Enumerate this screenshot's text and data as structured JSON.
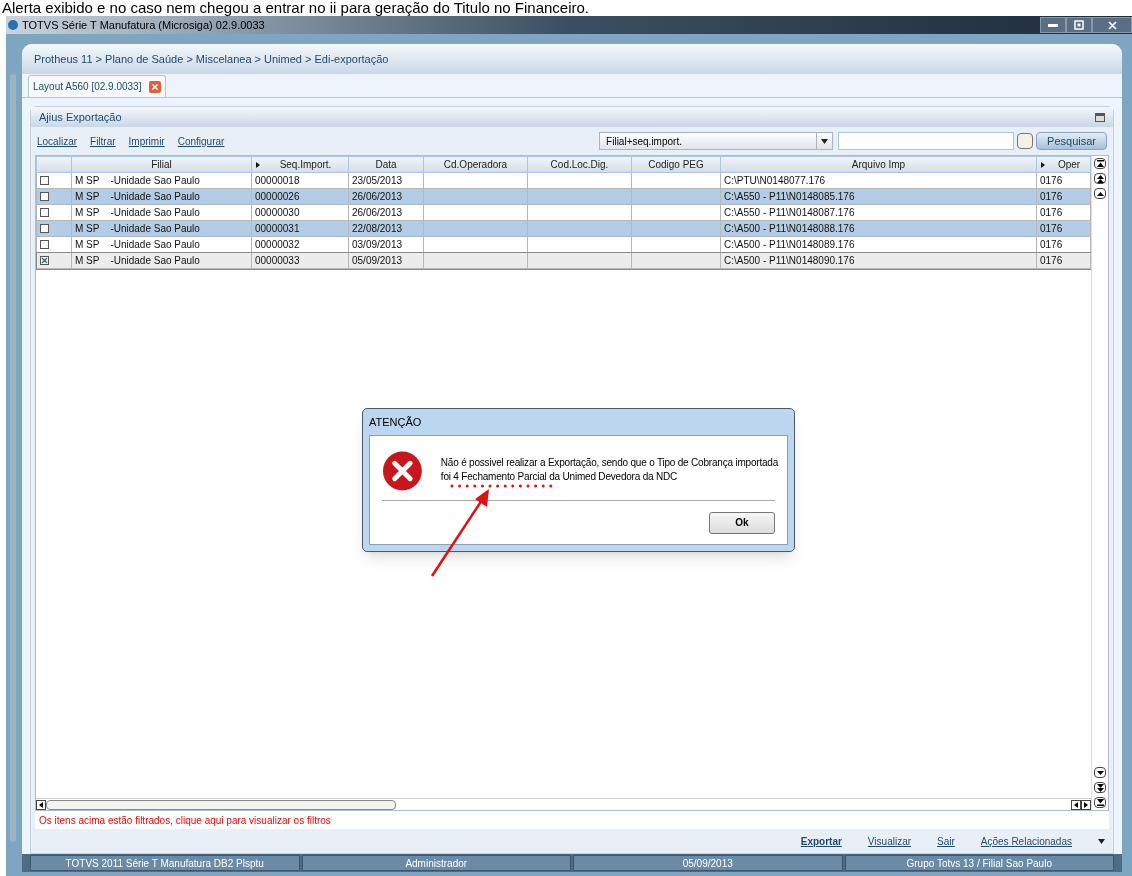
{
  "caption": "Alerta exibido e no caso nem chegou a entrar no ii para geração do Titulo no Financeiro.",
  "window": {
    "title": "TOTVS Série T Manufatura (Microsiga) 02.9.0033"
  },
  "breadcrumb": "Protheus 11 > Plano de Saúde > Miscelanea > Unimed > Edi-exportação",
  "tabs": [
    {
      "label": "Layout A560 [02.9.0033]",
      "selected": true
    }
  ],
  "panel": {
    "title": "Ajius Exportação"
  },
  "toolbar_links": [
    "Localizar",
    "Filtrar",
    "Imprimir",
    "Configurar"
  ],
  "search": {
    "index": "Filial+seq.import.",
    "button": "Pesquisar"
  },
  "table": {
    "columns": [
      {
        "label": "Filial",
        "sort": false
      },
      {
        "label": "Seq.Import.",
        "sort": true
      },
      {
        "label": "Data",
        "sort": false
      },
      {
        "label": "Cd.Operadora",
        "sort": false
      },
      {
        "label": "Cod.Loc.Dig.",
        "sort": false
      },
      {
        "label": "Codigo PEG",
        "sort": false
      },
      {
        "label": "Arquivo Imp",
        "sort": false
      },
      {
        "label": "Oper",
        "sort": true
      }
    ],
    "rows": [
      {
        "checked": false,
        "selected": false,
        "current": false,
        "cells": [
          "M SP    -Unidade Sao Paulo",
          "00000018",
          "23/05/2013",
          "",
          "",
          "",
          "C:\\PTU\\N0148077.176",
          "0176"
        ]
      },
      {
        "checked": false,
        "selected": true,
        "current": false,
        "cells": [
          "M SP    -Unidade Sao Paulo",
          "00000026",
          "26/06/2013",
          "",
          "",
          "",
          "C:\\A550 - P11\\N0148085.176",
          "0176"
        ]
      },
      {
        "checked": false,
        "selected": false,
        "current": false,
        "cells": [
          "M SP    -Unidade Sao Paulo",
          "00000030",
          "26/06/2013",
          "",
          "",
          "",
          "C:\\A550 - P11\\N0148087.176",
          "0176"
        ]
      },
      {
        "checked": false,
        "selected": true,
        "current": false,
        "cells": [
          "M SP    -Unidade Sao Paulo",
          "00000031",
          "22/08/2013",
          "",
          "",
          "",
          "C:\\A500 - P11\\N0148088.176",
          "0176"
        ]
      },
      {
        "checked": false,
        "selected": false,
        "current": false,
        "cells": [
          "M SP    -Unidade Sao Paulo",
          "00000032",
          "03/09/2013",
          "",
          "",
          "",
          "C:\\A500 - P11\\N0148089.176",
          "0176"
        ]
      },
      {
        "checked": true,
        "selected": false,
        "current": true,
        "cells": [
          "M SP    -Unidade Sao Paulo",
          "00000033",
          "05/09/2013",
          "",
          "",
          "",
          "C:\\A500 - P11\\N0148090.176",
          "0176"
        ]
      }
    ]
  },
  "filter_notice": "Os itens acima estão filtrados, clique aqui para visualizar os filtros",
  "actions": [
    {
      "label": "Exportar",
      "bold": true
    },
    {
      "label": "Visualizar",
      "bold": false
    },
    {
      "label": "Sair",
      "bold": false
    },
    {
      "label": "Ações Relacionadas",
      "bold": false
    }
  ],
  "status_bar": [
    "TOTVS 2011 Série T Manufatura DB2 Plsptu",
    "Administrador",
    "05/09/2013",
    "Grupo Totvs 13 / Filial Sao Paulo"
  ],
  "dialog": {
    "title": "ATENÇÃO",
    "message": "Não é possivel realizar a Exportação, sendo que o Tipo de Cobrança importada foi 4 Fechamento Parcial da Unimed Devedora da NDC",
    "button": "Ok"
  }
}
